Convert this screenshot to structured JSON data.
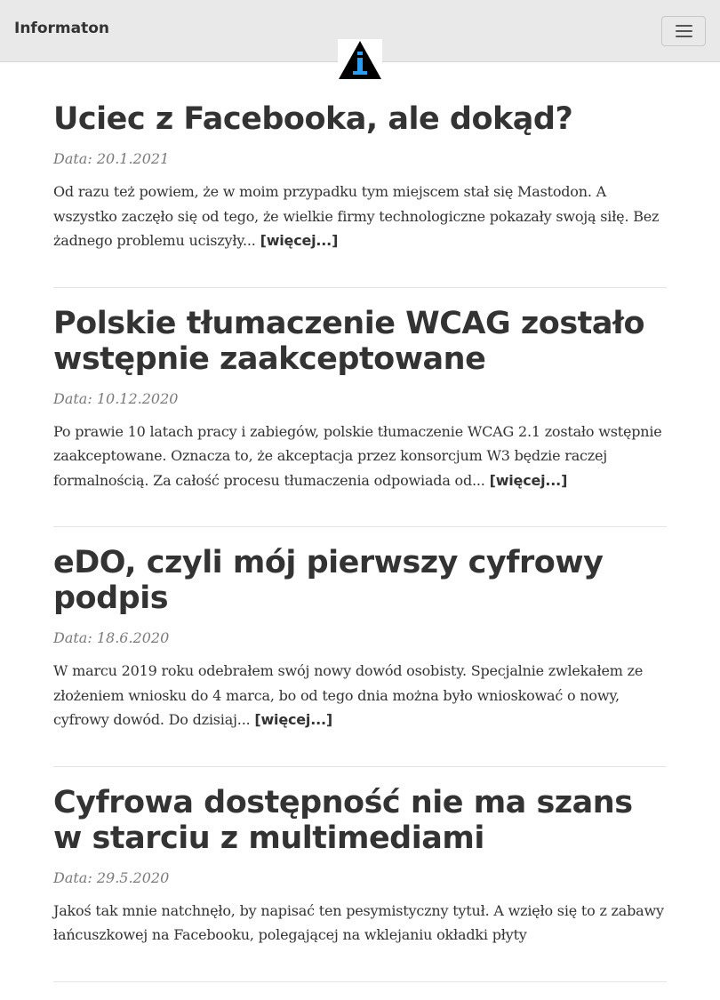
{
  "navbar": {
    "brand": "Informaton",
    "menu_icon": "hamburger-icon"
  },
  "logo": {
    "icon": "info-triangle-logo",
    "letter": "i",
    "colors": {
      "triangle": "#000000",
      "letter": "#2a9df4"
    }
  },
  "posts": [
    {
      "title": "Uciec z Facebooka, ale dokąd?",
      "date_label": "Data:",
      "date": "20.1.2021",
      "excerpt": "Od razu też powiem, że w moim przypadku tym miejscem stał się Mastodon. A wszystko zaczęło się od tego, że wielkie firmy technologiczne pokazały swoją siłę. Bez żadnego problemu uciszyły...",
      "more": "[więcej...]"
    },
    {
      "title": "Polskie tłumaczenie WCAG zostało wstępnie zaakceptowane",
      "date_label": "Data:",
      "date": "10.12.2020",
      "excerpt": "Po prawie 10 latach pracy i zabiegów, polskie tłumaczenie WCAG 2.1 zostało wstępnie zaakceptowane. Oznacza to, że akceptacja przez konsorcjum W3 będzie raczej formalnością. Za całość procesu tłumaczenia odpowiada od...",
      "more": "[więcej...]"
    },
    {
      "title": "eDO, czyli mój pierwszy cyfrowy podpis",
      "date_label": "Data:",
      "date": "18.6.2020",
      "excerpt": "W marcu 2019 roku odebrałem swój nowy dowód osobisty. Specjalnie zwlekałem ze złożeniem wniosku do 4 marca, bo od tego dnia można było wnioskować o nowy, cyfrowy dowód. Do dzisiaj...",
      "more": "[więcej...]"
    },
    {
      "title": "Cyfrowa dostępność nie ma szans w starciu z multimediami",
      "date_label": "Data:",
      "date": "29.5.2020",
      "excerpt": "Jakoś tak mnie natchnęło, by napisać ten pesymistyczny tytuł. A wzięło się to z zabawy łańcuszkowej na Facebooku, polegającej na wklejaniu okładki płyty",
      "more": ""
    }
  ]
}
